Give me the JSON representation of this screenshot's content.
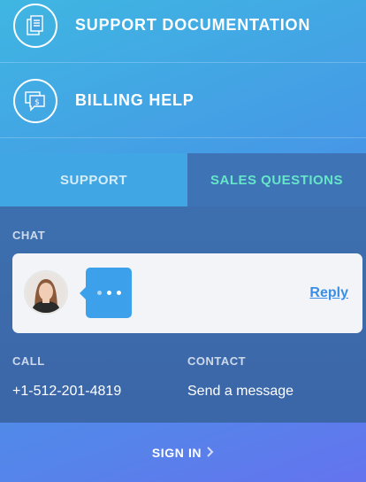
{
  "menu": {
    "support_docs_label": "SUPPORT DOCUMENTATION",
    "billing_label": "BILLING HELP"
  },
  "tabs": {
    "support": "SUPPORT",
    "sales": "SALES QUESTIONS",
    "active": "SALES QUESTIONS"
  },
  "chat": {
    "label": "CHAT",
    "reply": "Reply"
  },
  "call": {
    "label": "CALL",
    "phone": "+1-512-201-4819"
  },
  "contact": {
    "label": "CONTACT",
    "action": "Send a message"
  },
  "signin": {
    "label": "SIGN IN"
  },
  "colors": {
    "active_tab_text": "#66e6c8",
    "reply_link": "#3b8ee6",
    "bubble": "#3da0ea"
  },
  "icons": [
    "documents-icon",
    "billing-chat-icon",
    "typing-dots-icon",
    "chevron-right-icon"
  ]
}
